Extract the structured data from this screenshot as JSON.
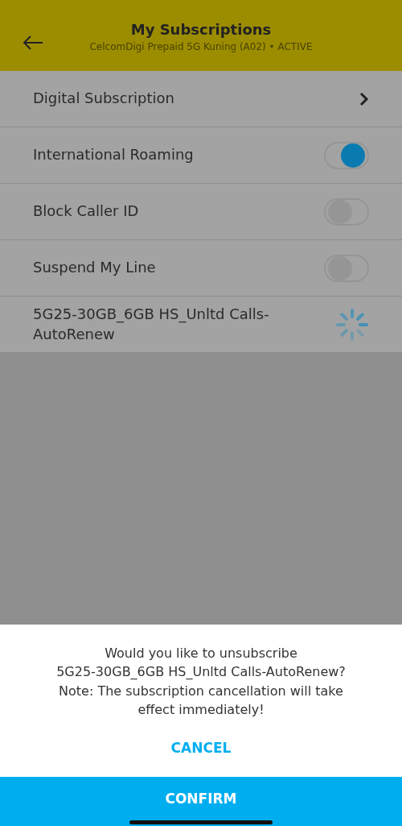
{
  "header": {
    "title": "My Subscriptions",
    "subtitle": "CelcomDigi Prepaid 5G Kuning (A02) • ACTIVE"
  },
  "rows": [
    {
      "kind": "link",
      "label": "Digital Subscription"
    },
    {
      "kind": "toggle",
      "label": "International Roaming",
      "on": true
    },
    {
      "kind": "toggle",
      "label": "Block Caller ID",
      "on": false
    },
    {
      "kind": "toggle",
      "label": "Suspend My Line",
      "on": false
    },
    {
      "kind": "loading",
      "label": "5G25-30GB_6GB HS_Unltd Calls-\nAutoRenew"
    }
  ],
  "dialog": {
    "message": "Would you like to unsubscribe\n5G25-30GB_6GB HS_Unltd Calls-AutoRenew?\nNote: The subscription cancellation will take\neffect immediately!",
    "cancel": "CANCEL",
    "confirm": "CONFIRM"
  }
}
